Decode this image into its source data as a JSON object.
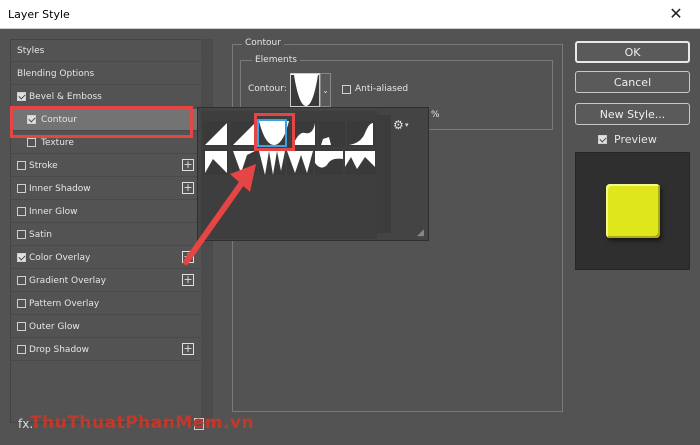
{
  "window": {
    "title": "Layer Style",
    "close_glyph": "✕"
  },
  "sidebar": {
    "header": "Styles",
    "blending": "Blending Options",
    "items": [
      {
        "label": "Bevel & Emboss",
        "checked": true
      },
      {
        "label": "Contour",
        "checked": true,
        "selected": true
      },
      {
        "label": "Texture",
        "checked": false
      },
      {
        "label": "Stroke",
        "checked": false,
        "plus": true
      },
      {
        "label": "Inner Shadow",
        "checked": false,
        "plus": true
      },
      {
        "label": "Inner Glow",
        "checked": false
      },
      {
        "label": "Satin",
        "checked": false
      },
      {
        "label": "Color Overlay",
        "checked": true,
        "plus": true
      },
      {
        "label": "Gradient Overlay",
        "checked": false,
        "plus": true
      },
      {
        "label": "Pattern Overlay",
        "checked": false
      },
      {
        "label": "Outer Glow",
        "checked": false
      },
      {
        "label": "Drop Shadow",
        "checked": false,
        "plus": true
      }
    ],
    "footer_fx": "fx."
  },
  "contour_panel": {
    "group_title": "Contour",
    "elements_title": "Elements",
    "contour_label": "Contour:",
    "anti_aliased_label": "Anti-aliased",
    "anti_aliased_checked": false,
    "range_suffix": "%",
    "picker_gear": "⚙"
  },
  "buttons": {
    "ok": "OK",
    "cancel": "Cancel",
    "new_style": "New Style..."
  },
  "preview": {
    "label": "Preview",
    "checked": true,
    "swatch_color": "#dfe61b"
  },
  "watermark": "ThuThuatPhanMem.vn",
  "colors": {
    "highlight": "#e64545",
    "selected_contour": "#3aa3e3"
  }
}
